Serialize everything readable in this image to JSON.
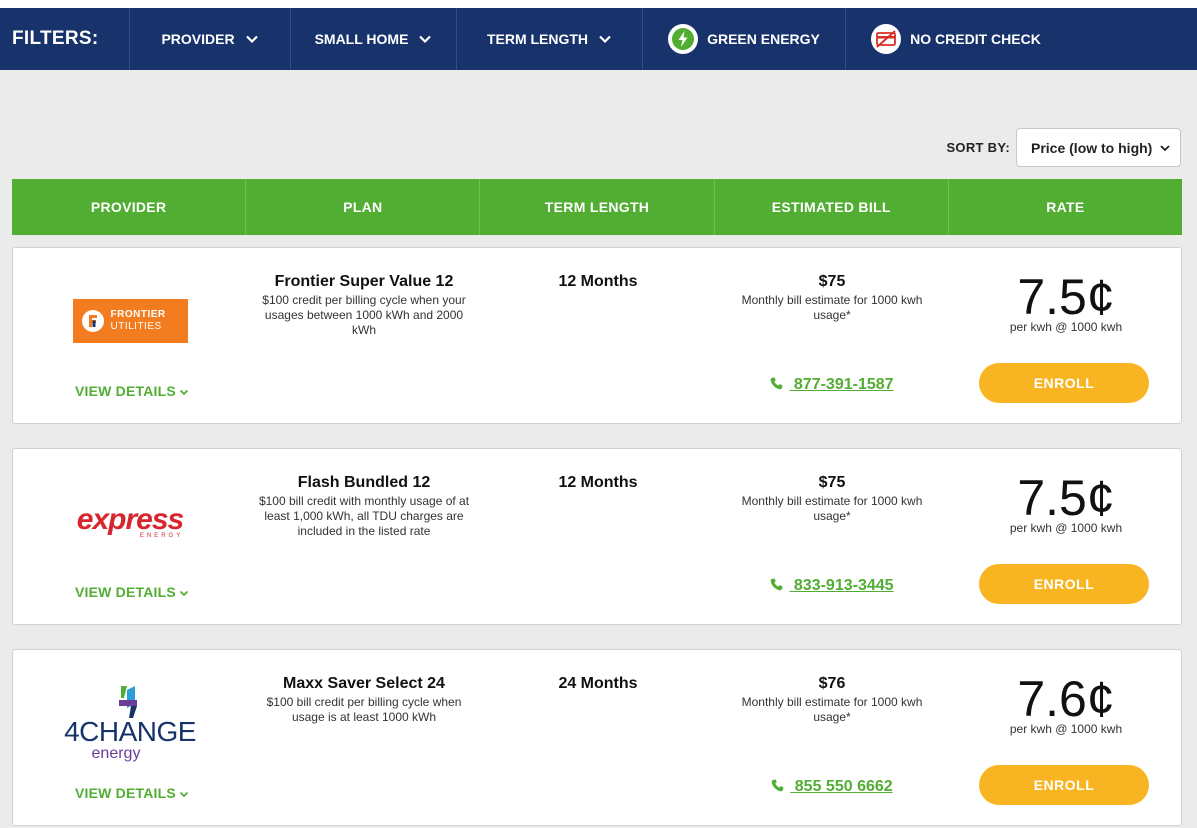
{
  "filters": {
    "title": "FILTERS:",
    "provider": "PROVIDER",
    "home_size": "SMALL HOME",
    "term_length": "TERM LENGTH",
    "green_energy": "GREEN ENERGY",
    "no_credit_check": "NO CREDIT CHECK"
  },
  "sort": {
    "label": "SORT BY:",
    "selected": "Price (low to high)"
  },
  "table_headers": [
    "PROVIDER",
    "PLAN",
    "TERM LENGTH",
    "ESTIMATED BILL",
    "RATE"
  ],
  "plans": [
    {
      "logo": {
        "line1": "FRONTIER",
        "line2": "UTILITIES",
        "icon": "frontier-utilities-logo"
      },
      "view_details": "VIEW DETAILS",
      "name": "Frontier Super Value 12",
      "description": "$100 credit per billing cycle when your usages between 1000 kWh and 2000 kWh",
      "term": "12 Months",
      "bill": "$75",
      "bill_note": "Monthly bill estimate for 1000 kwh usage*",
      "phone": "877-391-1587",
      "rate": "7.5¢",
      "rate_note": "per kwh @ 1000 kwh",
      "enroll": "ENROLL"
    },
    {
      "logo": {
        "line1": "express",
        "line2": "ENERGY",
        "icon": "express-energy-logo"
      },
      "view_details": "VIEW DETAILS",
      "name": "Flash Bundled 12",
      "description": "$100 bill credit with monthly usage of at least 1,000 kWh, all TDU charges are included in the listed rate",
      "term": "12 Months",
      "bill": "$75",
      "bill_note": "Monthly bill estimate for 1000 kwh usage*",
      "phone": "833-913-3445",
      "rate": "7.5¢",
      "rate_note": "per kwh @ 1000 kwh",
      "enroll": "ENROLL"
    },
    {
      "logo": {
        "line1": "4CHANGE",
        "line2": "energy",
        "icon": "4change-energy-logo"
      },
      "view_details": "VIEW DETAILS",
      "name": "Maxx Saver Select 24",
      "description": "$100 bill credit per billing cycle when usage is at least 1000 kWh",
      "term": "24 Months",
      "bill": "$76",
      "bill_note": "Monthly bill estimate for 1000 kwh usage*",
      "phone": "855 550 6662",
      "rate": "7.6¢",
      "rate_note": "per kwh @ 1000 kwh",
      "enroll": "ENROLL"
    }
  ],
  "colors": {
    "nav_bg": "#18336b",
    "header_green": "#52ad33",
    "enroll_yellow": "#f8b521",
    "page_bg": "#ebebeb"
  }
}
